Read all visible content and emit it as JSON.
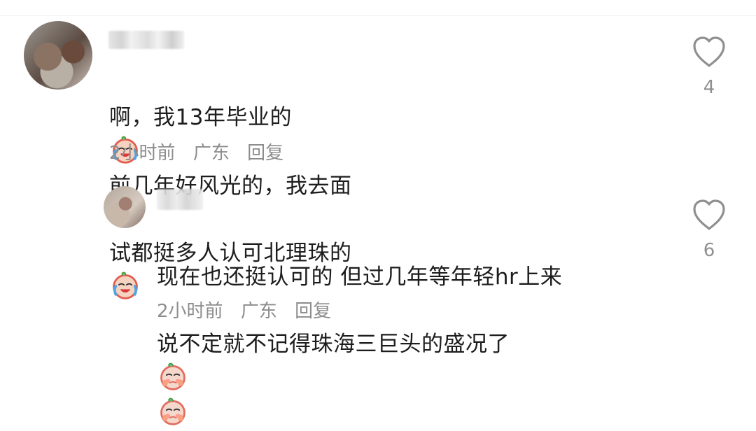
{
  "comments": [
    {
      "text_line_1": "啊，我13年毕业的",
      "text_line_1_after_emoji": "前几年好风光的，我去面",
      "text_line_2": "试都挺多人认可北理珠的",
      "time": "2小时前",
      "location": "广东",
      "reply_label": "回复",
      "likes": "4",
      "emoji_1": "crying-laughing-face-emoji",
      "emoji_2": "crying-laughing-face-emoji"
    },
    {
      "text_line_1": "现在也还挺认可的 但过几年等年轻hr上来",
      "text_line_2": "说不定就不记得珠海三巨头的盛况了",
      "time": "2小时前",
      "location": "广东",
      "reply_label": "回复",
      "likes": "6",
      "emoji_1": "shy-face-emoji",
      "emoji_2": "shy-face-emoji"
    }
  ],
  "colors": {
    "text": "#1d1d1d",
    "meta": "#8d8d8d",
    "heart": "#8f8f8f"
  }
}
